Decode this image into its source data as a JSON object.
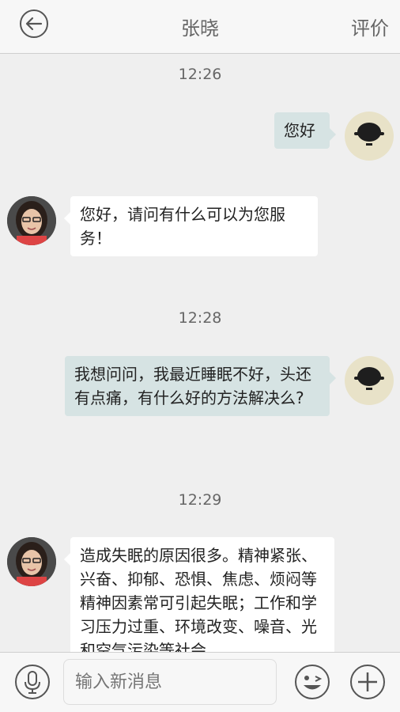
{
  "header": {
    "title": "张晓",
    "rate_label": "评价",
    "back_icon": "back-arrow-icon"
  },
  "messages": [
    {
      "time": "12:26"
    },
    {
      "sender": "self",
      "text": "您好"
    },
    {
      "sender": "doctor",
      "text": "您好，请问有什么可以为您服务！"
    },
    {
      "time": "12:28"
    },
    {
      "sender": "self",
      "text": "我想问问，我最近睡眠不好，头还有点痛，有什么好的方法解决么?"
    },
    {
      "time": "12:29"
    },
    {
      "sender": "doctor",
      "text": "造成失眠的原因很多。精神紧张、兴奋、抑郁、恐惧、焦虑、烦闷等精神因素常可引起失眠；工作和学习压力过重、环境改变、噪音、光和空气污染等社会"
    }
  ],
  "input": {
    "placeholder": "输入新消息"
  },
  "icons": {
    "voice": "microphone-icon",
    "emoji": "emoji-icon",
    "plus": "plus-icon"
  },
  "colors": {
    "outgoing_bubble": "#d6e3e3",
    "incoming_bubble": "#ffffff",
    "background": "#efefef"
  }
}
